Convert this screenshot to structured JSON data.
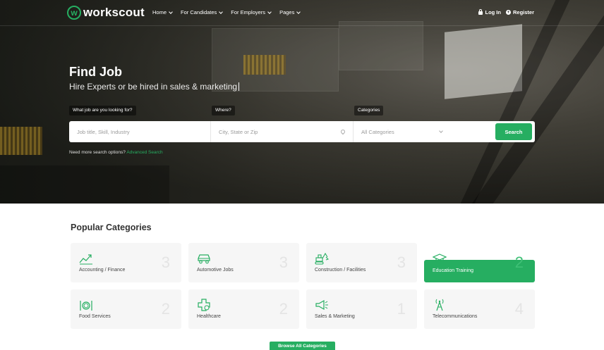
{
  "brand": {
    "logo_letter": "w",
    "name": "workscout",
    "accent": "#26ae61"
  },
  "nav": [
    {
      "label": "Home"
    },
    {
      "label": "For Candidates"
    },
    {
      "label": "For Employers"
    },
    {
      "label": "Pages"
    }
  ],
  "auth": {
    "login": "Log In",
    "register": "Register"
  },
  "hero": {
    "title": "Find Job",
    "subtitle": "Hire Experts or be hired in sales & marketing",
    "labels": {
      "job": "What job are you looking for?",
      "where": "Where?",
      "categories": "Categories"
    },
    "placeholders": {
      "job": "Job title, Skill, Industry",
      "where": "City, State or Zip"
    },
    "category_value": "All Categories",
    "search_label": "Search",
    "advanced_prefix": "Need more search options?",
    "advanced_link": "Advanced Search"
  },
  "categories": {
    "title": "Popular Categories",
    "items": [
      {
        "name": "Accounting / Finance",
        "count": "3",
        "icon": "chart-icon"
      },
      {
        "name": "Automotive Jobs",
        "count": "3",
        "icon": "car-icon"
      },
      {
        "name": "Construction / Facilities",
        "count": "3",
        "icon": "excavator-icon"
      },
      {
        "name": "Education Training",
        "count": "2",
        "icon": "graduation-cap-icon",
        "active": true
      },
      {
        "name": "Food Services",
        "count": "2",
        "icon": "plate-cutlery-icon"
      },
      {
        "name": "Healthcare",
        "count": "2",
        "icon": "medical-cross-icon"
      },
      {
        "name": "Sales & Marketing",
        "count": "1",
        "icon": "megaphone-icon"
      },
      {
        "name": "Telecommunications",
        "count": "4",
        "icon": "antenna-icon"
      }
    ],
    "browse_label": "Browse All Categories"
  }
}
